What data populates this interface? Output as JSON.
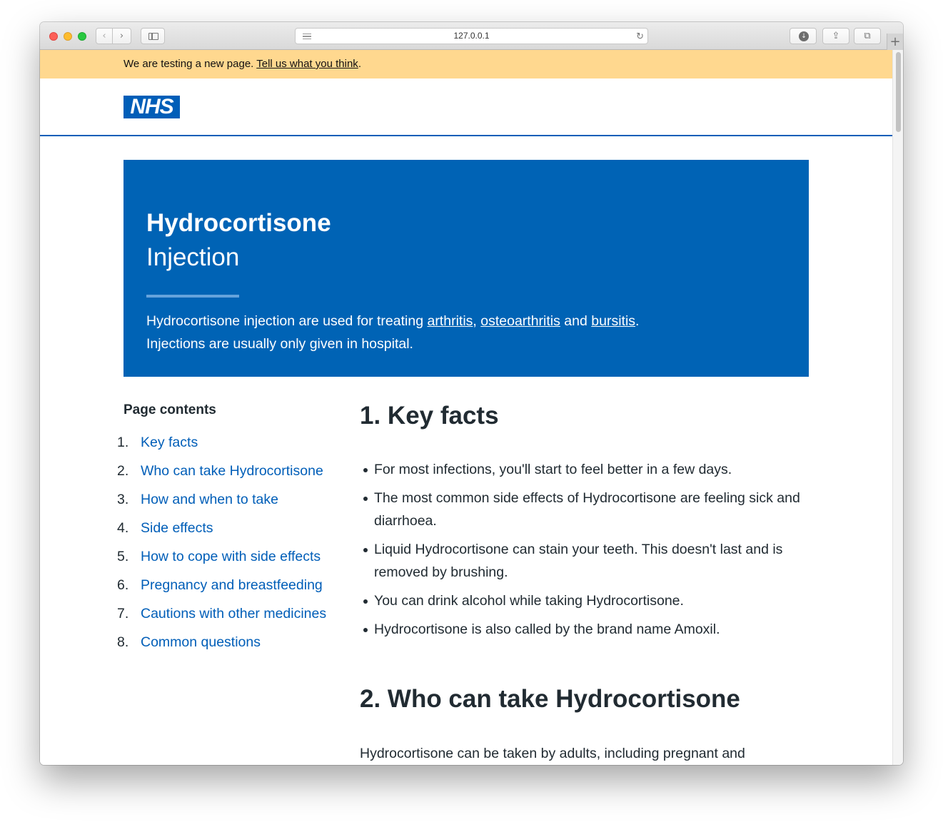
{
  "browser": {
    "url": "127.0.0.1",
    "back_glyph": "‹",
    "forward_glyph": "›",
    "reload_glyph": "↻",
    "download_glyph": "↓",
    "share_glyph": "⇪",
    "tabs_glyph": "⧉",
    "new_tab_glyph": "+",
    "icons": [
      "back-chevron-icon",
      "forward-chevron-icon",
      "sidebar-icon",
      "reader-icon",
      "reload-icon",
      "download-icon",
      "share-icon",
      "tabs-overview-icon",
      "plus-icon"
    ]
  },
  "banner": {
    "text": "We are testing a new page. ",
    "link": "Tell us what you think",
    "suffix": ".",
    "background": "#ffd88f"
  },
  "header": {
    "logo": "NHS",
    "brand_color": "#005eb8"
  },
  "hero": {
    "title": "Hydrocortisone",
    "subtitle": "Injection",
    "desc_prefix": "Hydrocortisone injection are used for treating ",
    "link_arthritis": "arthritis",
    "comma": ", ",
    "link_osteoarthritis": "osteoarthritis",
    "and_text": " and ",
    "link_bursitis": "bursitis",
    "desc_suffix": ". Injections are usually only given in hospital.",
    "background": "#0063b5"
  },
  "toc": {
    "heading": "Page contents",
    "items": [
      {
        "num": "1.",
        "label": "Key facts"
      },
      {
        "num": "2.",
        "label": "Who can take Hydrocortisone"
      },
      {
        "num": "3.",
        "label": "How and when to take"
      },
      {
        "num": "4.",
        "label": "Side effects"
      },
      {
        "num": "5.",
        "label": "How to cope with side effects"
      },
      {
        "num": "6.",
        "label": "Pregnancy and breastfeeding"
      },
      {
        "num": "7.",
        "label": "Cautions with other medicines"
      },
      {
        "num": "8.",
        "label": "Common questions"
      }
    ],
    "link_color": "#005eb8"
  },
  "main": {
    "key_facts_heading": "1. Key facts",
    "facts": [
      "For most infections, you'll start to feel better in a few days.",
      "The most common side effects of Hydrocortisone are feeling sick and diarrhoea.",
      "Liquid Hydrocortisone can stain your teeth. This doesn't last and is removed by brushing.",
      "You can drink alcohol while taking Hydrocortisone.",
      "Hydrocortisone is also called by the brand name Amoxil."
    ],
    "who_heading": "2. Who can take Hydrocortisone",
    "who_text": "Hydrocortisone can be taken by adults, including pregnant and"
  }
}
